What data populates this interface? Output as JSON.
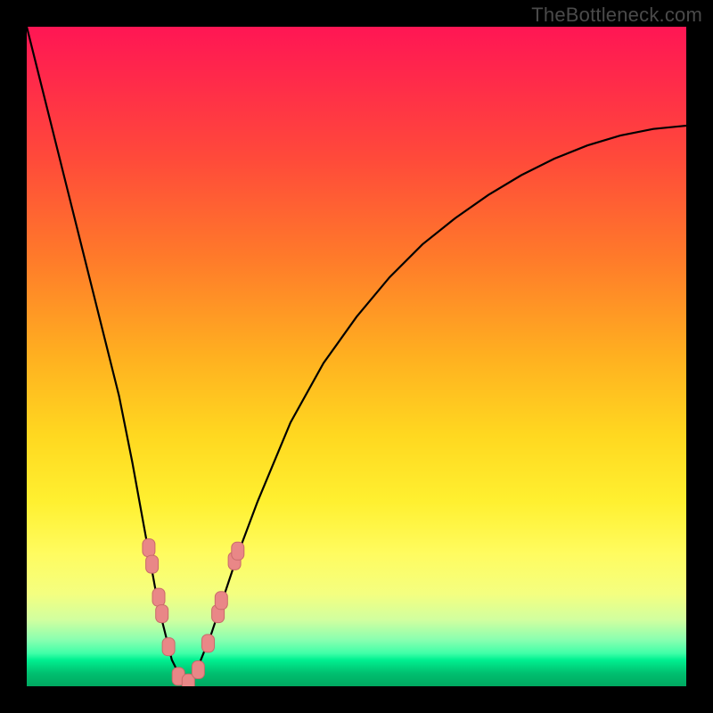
{
  "watermark": "TheBottleneck.com",
  "colors": {
    "frame": "#000000",
    "curve": "#000000",
    "marker_fill": "#e98787",
    "marker_stroke": "#c96a6a"
  },
  "chart_data": {
    "type": "line",
    "title": "",
    "xlabel": "",
    "ylabel": "",
    "xlim": [
      0,
      100
    ],
    "ylim": [
      0,
      100
    ],
    "description": "V-shaped bottleneck curve — y represents bottleneck/error percentage, minimized at x≈24; background gradient red→green maps high→low values",
    "series": [
      {
        "name": "bottleneck-curve",
        "x": [
          0,
          2,
          4,
          6,
          8,
          10,
          12,
          14,
          16,
          18,
          20,
          22,
          24,
          26,
          28,
          30,
          32,
          35,
          40,
          45,
          50,
          55,
          60,
          65,
          70,
          75,
          80,
          85,
          90,
          95,
          100
        ],
        "values": [
          100,
          92,
          84,
          76,
          68,
          60,
          52,
          44,
          34,
          23,
          12,
          4,
          0,
          3,
          8,
          14,
          20,
          28,
          40,
          49,
          56,
          62,
          67,
          71,
          74.5,
          77.5,
          80,
          82,
          83.5,
          84.5,
          85
        ]
      }
    ],
    "markers": [
      {
        "x": 18.5,
        "y": 21.0
      },
      {
        "x": 19.0,
        "y": 18.5
      },
      {
        "x": 20.0,
        "y": 13.5
      },
      {
        "x": 20.5,
        "y": 11.0
      },
      {
        "x": 21.5,
        "y": 6.0
      },
      {
        "x": 23.0,
        "y": 1.5
      },
      {
        "x": 24.5,
        "y": 0.5
      },
      {
        "x": 26.0,
        "y": 2.5
      },
      {
        "x": 27.5,
        "y": 6.5
      },
      {
        "x": 29.0,
        "y": 11.0
      },
      {
        "x": 29.5,
        "y": 13.0
      },
      {
        "x": 31.5,
        "y": 19.0
      },
      {
        "x": 32.0,
        "y": 20.5
      }
    ],
    "grid": false,
    "legend": false
  }
}
